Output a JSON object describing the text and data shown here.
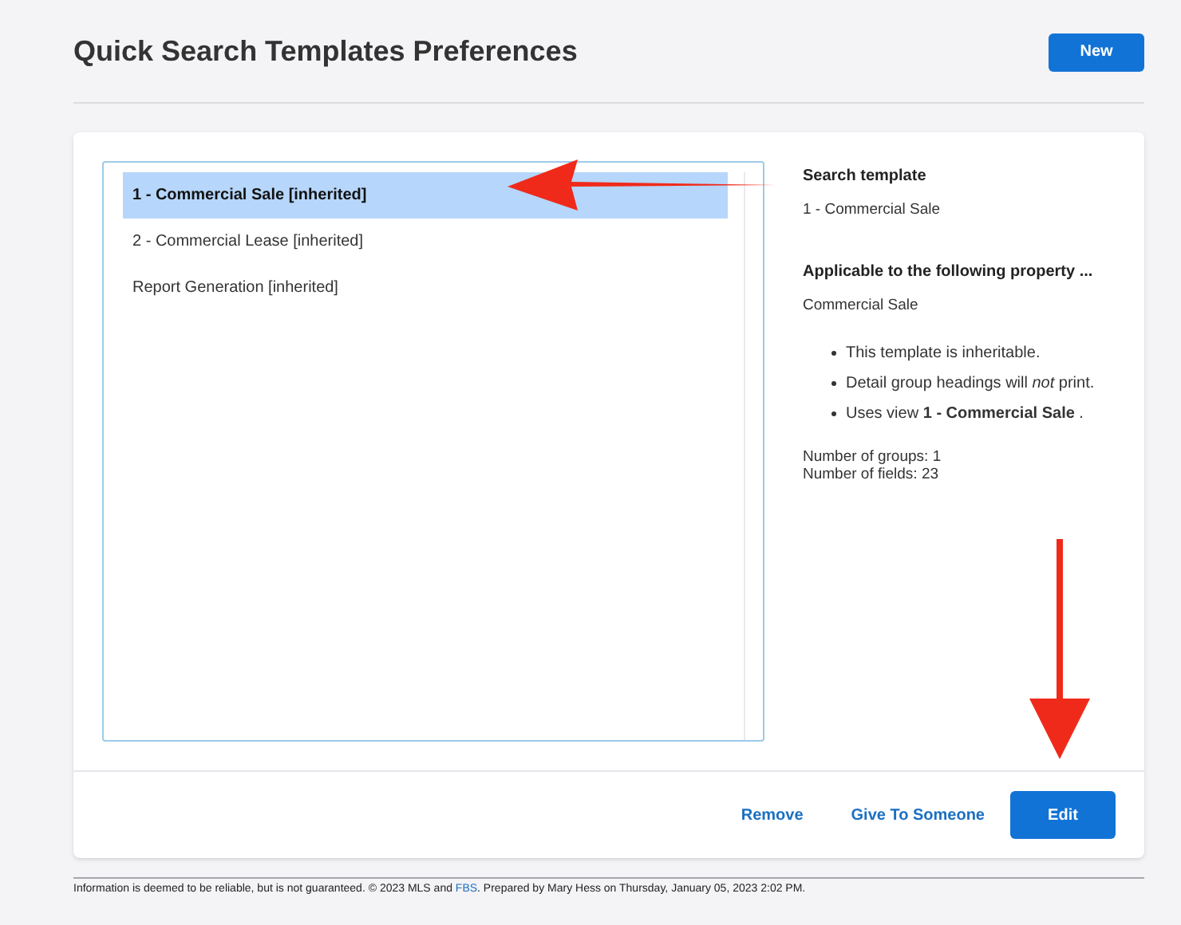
{
  "header": {
    "title": "Quick Search Templates Preferences",
    "new_button": "New"
  },
  "templates": [
    {
      "label": "1 - Commercial Sale [inherited]",
      "selected": true
    },
    {
      "label": "2 - Commercial Lease [inherited]",
      "selected": false
    },
    {
      "label": "Report Generation [inherited]",
      "selected": false
    }
  ],
  "details": {
    "template_heading": "Search template",
    "template_value": "1 - Commercial Sale",
    "applicable_heading": "Applicable to the following property ...",
    "applicable_value": "Commercial Sale",
    "bullets": [
      "This template is inheritable.",
      "Detail group headings will *not* print.",
      "Uses view **1 - Commercial Sale** ."
    ],
    "stats": [
      "Number of groups: 1",
      "Number of fields: 23"
    ]
  },
  "actions": {
    "remove": "Remove",
    "give": "Give To Someone",
    "edit": "Edit"
  },
  "footer": {
    "before": "Information is deemed to be reliable, but is not guaranteed. © 2023 MLS and ",
    "link": "FBS",
    "after": ". Prepared by Mary Hess on Thursday, January 05, 2023 2:02 PM."
  }
}
